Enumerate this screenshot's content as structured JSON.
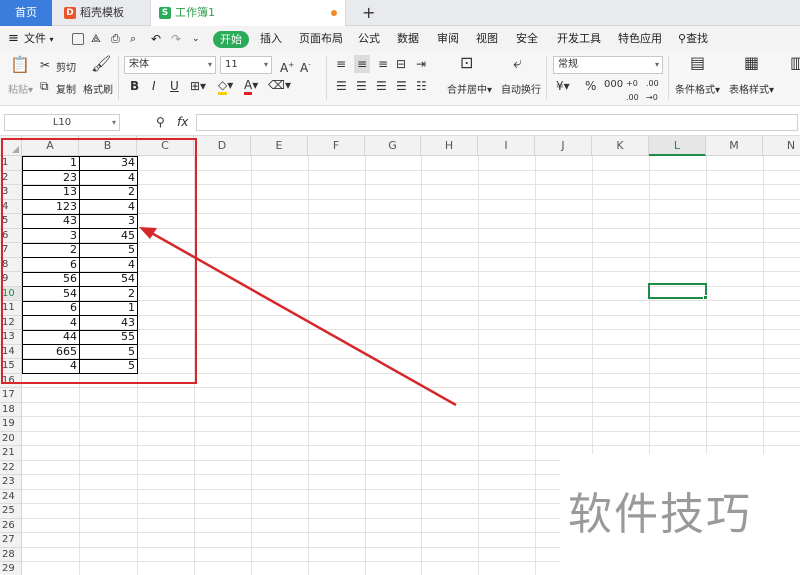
{
  "tabs": {
    "home": "首页",
    "template": "稻壳模板",
    "document": "工作簿1",
    "add": "+"
  },
  "menu": {
    "file": "文件",
    "start": "开始",
    "insert": "插入",
    "layout": "页面布局",
    "formula": "公式",
    "data": "数据",
    "review": "审阅",
    "view": "视图",
    "security": "安全",
    "dev": "开发工具",
    "special": "特色应用",
    "search": "查找"
  },
  "ribbon": {
    "paste": "粘贴",
    "cut": "剪切",
    "copy": "复制",
    "format_painter": "格式刷",
    "font_name": "宋体",
    "font_size": "11",
    "merge_center": "合并居中",
    "wrap_text": "自动换行",
    "number_format": "常规",
    "cond_format": "条件格式",
    "table_style": "表格样式"
  },
  "formula_bar": {
    "name_box": "L10",
    "fx": "fx"
  },
  "columns": [
    "A",
    "B",
    "C",
    "D",
    "E",
    "F",
    "G",
    "H",
    "I",
    "J",
    "K",
    "L",
    "M",
    "N"
  ],
  "rows": [
    "1",
    "2",
    "3",
    "4",
    "5",
    "6",
    "7",
    "8",
    "9",
    "10",
    "11",
    "12",
    "13",
    "14",
    "15",
    "16",
    "17",
    "18",
    "19",
    "20",
    "21",
    "22",
    "23",
    "24",
    "25",
    "26",
    "27",
    "28",
    "29"
  ],
  "col_a_values": [
    "1",
    "23",
    "13",
    "123",
    "43",
    "3",
    "2",
    "6",
    "56",
    "54",
    "6",
    "4",
    "44",
    "665",
    "4"
  ],
  "col_b_values": [
    "34",
    "4",
    "2",
    "4",
    "3",
    "45",
    "5",
    "4",
    "54",
    "2",
    "1",
    "43",
    "55",
    "5",
    "5"
  ],
  "selected_column": "L",
  "selected_row": "10",
  "watermark": "软件技巧",
  "colors": {
    "start_tab": "#2bab5a",
    "annotation": "#d6272b",
    "selection": "#1e8c45",
    "home_tab": "#3b7ddd"
  }
}
